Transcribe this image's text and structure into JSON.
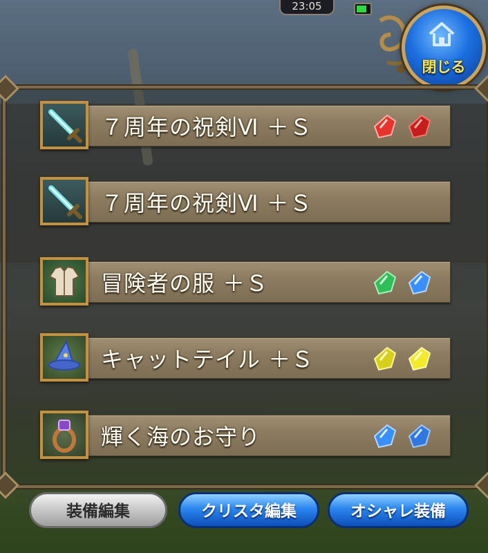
{
  "status": {
    "time": "23:05"
  },
  "close_button": {
    "label": "閉じる",
    "icon": "home-icon"
  },
  "equipment": [
    {
      "name": "７周年の祝剣Ⅵ ＋Ｓ",
      "icon": "sword-icon",
      "icon_color": "#6fe3e8",
      "crystals": [
        "#e8332d",
        "#c81d1d"
      ]
    },
    {
      "name": "７周年の祝剣Ⅵ ＋Ｓ",
      "icon": "sword-icon",
      "icon_color": "#6fe3e8",
      "crystals": []
    },
    {
      "name": "冒険者の服 ＋Ｓ",
      "icon": "clothing-icon",
      "icon_color": "#e9dcc6",
      "crystals": [
        "#2fbf58",
        "#3a8fff"
      ]
    },
    {
      "name": "キャットテイル ＋Ｓ",
      "icon": "wizard-hat-icon",
      "icon_color": "#5a7fe6",
      "crystals": [
        "#d8cf1d",
        "#f2ea2a"
      ]
    },
    {
      "name": "輝く海のお守り",
      "icon": "ring-icon",
      "icon_color": "#c1773a",
      "crystals": [
        "#3a8fff",
        "#2f78e0"
      ]
    }
  ],
  "footer": {
    "edit_equipment": "装備編集",
    "edit_crysta": "クリスタ編集",
    "fashion_equipment": "オシャレ装備"
  }
}
